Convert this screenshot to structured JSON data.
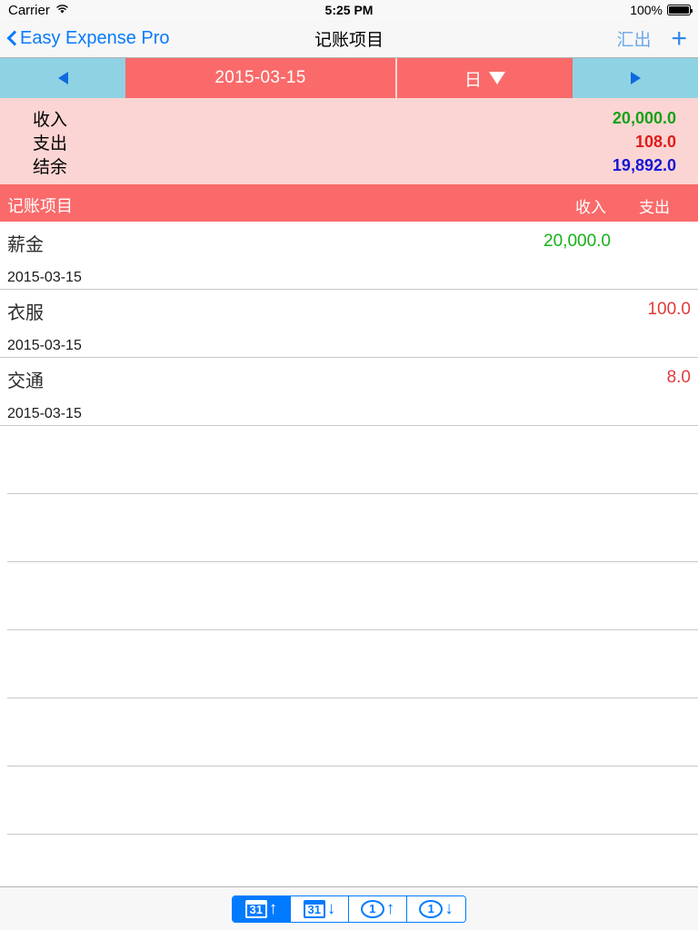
{
  "status_bar": {
    "carrier": "Carrier",
    "wifi_icon": "wifi-icon",
    "time": "5:25 PM",
    "battery_percent": "100%",
    "battery_icon": "battery-full-icon"
  },
  "nav_bar": {
    "back_icon": "chevron-left-icon",
    "back_label": "Easy Expense Pro",
    "title": "记账项目",
    "export_label": "汇出",
    "add_label": "+"
  },
  "date_bar": {
    "prev_icon": "triangle-left-icon",
    "current_date": "2015-03-15",
    "unit_label": "日",
    "unit_caret_icon": "triangle-down-icon",
    "next_icon": "triangle-right-icon",
    "colors": {
      "arrow_segment": "#8fd2e3",
      "date_segment": "#fa6a6a",
      "arrow_glyph": "#1069e0"
    }
  },
  "summary": {
    "background": "#fbd5d3",
    "rows": [
      {
        "label": "收入",
        "value": "20,000.0",
        "color": "#16a116"
      },
      {
        "label": "支出",
        "value": "108.0",
        "color": "#e01b1b"
      },
      {
        "label": "结余",
        "value": "19,892.0",
        "color": "#1515d8"
      }
    ]
  },
  "table_header": {
    "background": "#fa6a6a",
    "item": "记账项目",
    "income": "收入",
    "expense": "支出"
  },
  "transactions": [
    {
      "name": "薪金",
      "date": "2015-03-15",
      "income": "20,000.0",
      "expense": ""
    },
    {
      "name": "衣服",
      "date": "2015-03-15",
      "income": "",
      "expense": "100.0"
    },
    {
      "name": "交通",
      "date": "2015-03-15",
      "income": "",
      "expense": "8.0"
    }
  ],
  "empty_row_count": 6,
  "toolbar": {
    "segments": [
      {
        "id": "month-up",
        "glyph": "31",
        "glyph_type": "calendar",
        "arrow": "↑",
        "selected": true,
        "name": "prev-month-button"
      },
      {
        "id": "month-down",
        "glyph": "31",
        "glyph_type": "calendar",
        "arrow": "↓",
        "selected": false,
        "name": "next-month-button"
      },
      {
        "id": "day-up",
        "glyph": "1",
        "glyph_type": "circle",
        "arrow": "↑",
        "selected": false,
        "name": "prev-day-button"
      },
      {
        "id": "day-down",
        "glyph": "1",
        "glyph_type": "circle",
        "arrow": "↓",
        "selected": false,
        "name": "next-day-button"
      }
    ],
    "accent_color": "#007aff"
  }
}
